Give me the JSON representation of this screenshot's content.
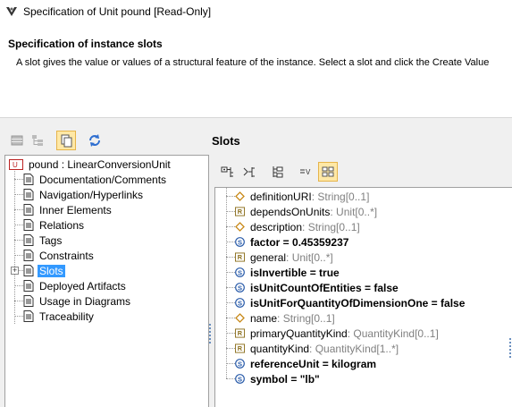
{
  "window": {
    "title": "Specification of Unit pound [Read-Only]"
  },
  "header": {
    "heading": "Specification of instance slots",
    "description": "A slot gives the value or values of a structural feature of the instance. Select a slot and click the Create Value"
  },
  "left_toolbar": {
    "buttons": [
      "properties-view",
      "hierarchy-view",
      "compact-view",
      "refresh"
    ],
    "active": "compact-view"
  },
  "tree": {
    "root": "pound : LinearConversionUnit",
    "items": [
      {
        "label": "Documentation/Comments"
      },
      {
        "label": "Navigation/Hyperlinks"
      },
      {
        "label": "Inner Elements"
      },
      {
        "label": "Relations"
      },
      {
        "label": "Tags"
      },
      {
        "label": "Constraints"
      },
      {
        "label": "Slots",
        "selected": true,
        "expandable": true
      },
      {
        "label": "Deployed Artifacts"
      },
      {
        "label": "Usage in Diagrams"
      },
      {
        "label": "Traceability"
      }
    ]
  },
  "slots_panel": {
    "title": "Slots",
    "toolbar": [
      "expand-all",
      "collapse-all",
      "sort",
      "show-values",
      "grid-view"
    ],
    "active": "grid-view",
    "rows": [
      {
        "icon": "diamond-icon",
        "name": "definitionURI",
        "type": " : String[0..1]",
        "bold": false
      },
      {
        "icon": "reference-icon",
        "name": "dependsOnUnits",
        "type": " : Unit[0..*]",
        "bold": false
      },
      {
        "icon": "diamond-icon",
        "name": "description",
        "type": " : String[0..1]",
        "bold": false
      },
      {
        "icon": "slot-value-icon",
        "name": "factor = 0.45359237",
        "type": "",
        "bold": true
      },
      {
        "icon": "reference-icon",
        "name": "general",
        "type": " : Unit[0..*]",
        "bold": false
      },
      {
        "icon": "slot-value-icon",
        "name": "isInvertible = true",
        "type": "",
        "bold": true
      },
      {
        "icon": "slot-value-icon",
        "name": "isUnitCountOfEntities = false",
        "type": "",
        "bold": true
      },
      {
        "icon": "slot-value-icon",
        "name": "isUnitForQuantityOfDimensionOne = false",
        "type": "",
        "bold": true
      },
      {
        "icon": "diamond-icon",
        "name": "name",
        "type": " : String[0..1]",
        "bold": false
      },
      {
        "icon": "reference-icon",
        "name": "primaryQuantityKind",
        "type": " : QuantityKind[0..1]",
        "bold": false
      },
      {
        "icon": "reference-icon",
        "name": "quantityKind",
        "type": " : QuantityKind[1..*]",
        "bold": false
      },
      {
        "icon": "slot-value-icon",
        "name": "referenceUnit = kilogram",
        "type": "",
        "bold": true
      },
      {
        "icon": "slot-value-icon",
        "name": "symbol = \"lb\"",
        "type": "",
        "bold": true
      }
    ]
  },
  "colors": {
    "selection": "#3399ff",
    "active_toggle": "#ffe8a6",
    "type_text": "#808080"
  }
}
